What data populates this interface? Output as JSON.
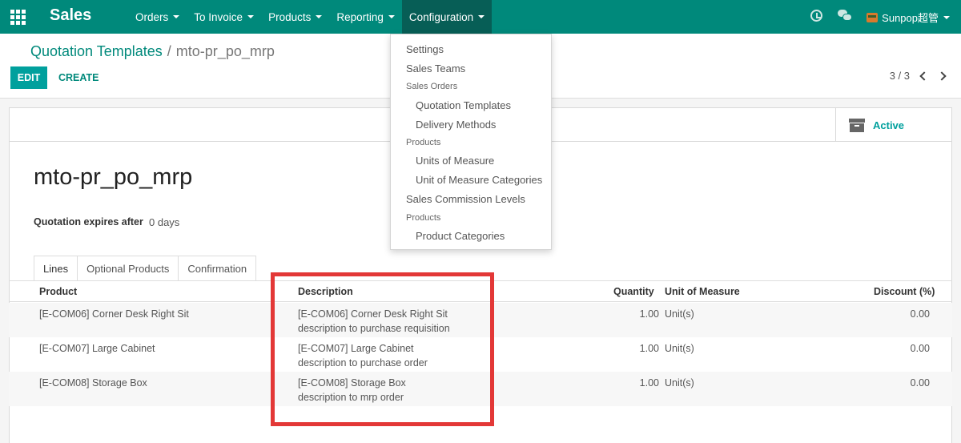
{
  "navbar": {
    "brand": "Sales",
    "menu": [
      {
        "label": "Orders"
      },
      {
        "label": "To Invoice"
      },
      {
        "label": "Products"
      },
      {
        "label": "Reporting"
      },
      {
        "label": "Configuration"
      }
    ],
    "user": "Sunpop超管",
    "accent": "#00897b"
  },
  "breadcrumb": {
    "parent": "Quotation Templates",
    "separator": "/",
    "current": "mto-pr_po_mrp"
  },
  "toolbar": {
    "edit_label": "EDIT",
    "create_label": "CREATE"
  },
  "pager": {
    "value": "3 / 3"
  },
  "form": {
    "status_button": "Active",
    "title": "mto-pr_po_mrp",
    "expiry_label": "Quotation expires after",
    "expiry_value": "0 days",
    "tabs": [
      {
        "label": "Lines"
      },
      {
        "label": "Optional Products"
      },
      {
        "label": "Confirmation"
      }
    ],
    "columns": {
      "product": "Product",
      "description": "Description",
      "quantity": "Quantity",
      "uom": "Unit of Measure",
      "discount": "Discount (%)"
    },
    "rows": [
      {
        "product": "[E-COM06] Corner Desk Right Sit",
        "desc1": "[E-COM06] Corner Desk Right Sit",
        "desc2": "description to purchase requisition",
        "quantity": "1.00",
        "uom": "Unit(s)",
        "discount": "0.00"
      },
      {
        "product": "[E-COM07] Large Cabinet",
        "desc1": "[E-COM07] Large Cabinet",
        "desc2": "description to purchase  order",
        "quantity": "1.00",
        "uom": "Unit(s)",
        "discount": "0.00"
      },
      {
        "product": "[E-COM08] Storage Box",
        "desc1": "[E-COM08] Storage Box",
        "desc2": "description to mrp order",
        "quantity": "1.00",
        "uom": "Unit(s)",
        "discount": "0.00"
      }
    ]
  },
  "dropdown": {
    "settings": "Settings",
    "sales_teams": "Sales Teams",
    "header_sales_orders": "Sales Orders",
    "quotation_templates": "Quotation Templates",
    "delivery_methods": "Delivery Methods",
    "header_products_1": "Products",
    "units_of_measure": "Units of Measure",
    "uom_categories": "Unit of Measure Categories",
    "commission_levels": "Sales Commission Levels",
    "header_products_2": "Products",
    "product_categories": "Product Categories"
  },
  "highlight_color": "#e33837"
}
